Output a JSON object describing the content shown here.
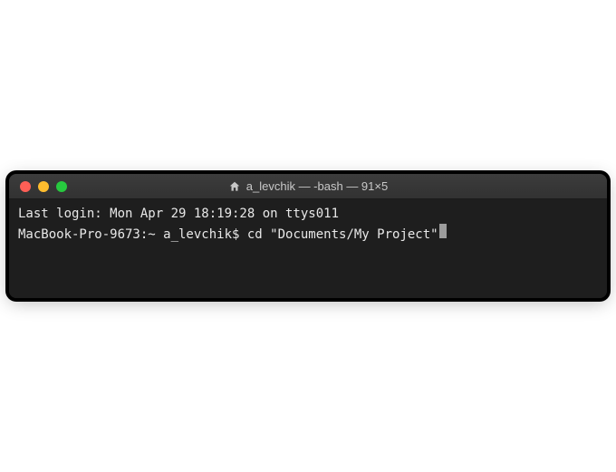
{
  "window": {
    "title": "a_levchik — -bash — 91×5"
  },
  "terminal": {
    "last_login_line": "Last login: Mon Apr 29 18:19:28 on ttys011",
    "prompt": "MacBook-Pro-9673:~ a_levchik$ ",
    "command": "cd \"Documents/My Project\""
  },
  "colors": {
    "bg": "#1e1e1e",
    "text": "#e8e8e8",
    "titlebar_text": "#c8c8c8",
    "close": "#ff5f56",
    "minimize": "#ffbd2e",
    "zoom": "#27c93f"
  }
}
